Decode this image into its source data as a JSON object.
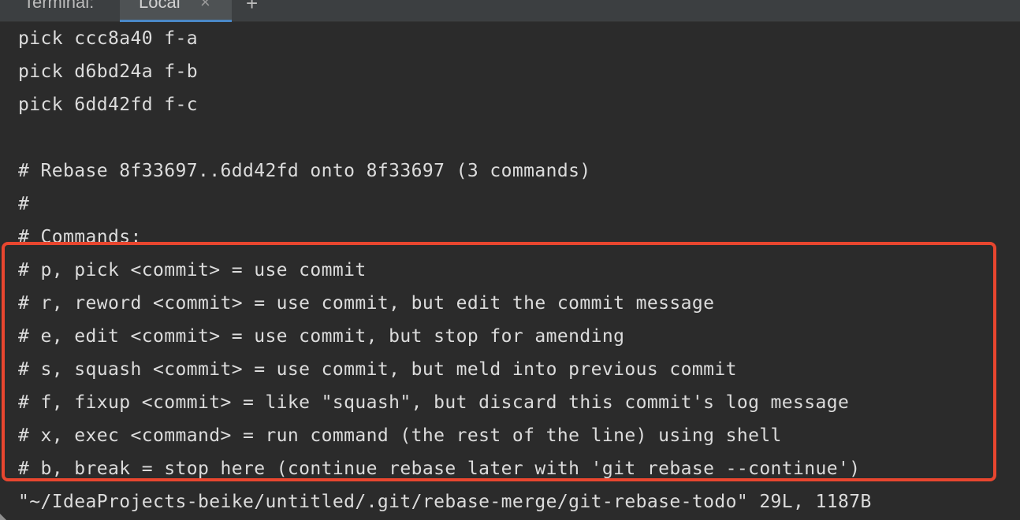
{
  "tabbar": {
    "title": "Terminal:",
    "active_tab": "Local",
    "close_glyph": "×",
    "add_glyph": "+"
  },
  "terminal": {
    "lines": [
      "pick ccc8a40 f-a",
      "pick d6bd24a f-b",
      "pick 6dd42fd f-c",
      "",
      "# Rebase 8f33697..6dd42fd onto 8f33697 (3 commands)",
      "#",
      "# Commands:",
      "# p, pick <commit> = use commit",
      "# r, reword <commit> = use commit, but edit the commit message",
      "# e, edit <commit> = use commit, but stop for amending",
      "# s, squash <commit> = use commit, but meld into previous commit",
      "# f, fixup <commit> = like \"squash\", but discard this commit's log message",
      "# x, exec <command> = run command (the rest of the line) using shell",
      "# b, break = stop here (continue rebase later with 'git rebase --continue')"
    ],
    "status_line": "\"~/IdeaProjects-beike/untitled/.git/rebase-merge/git-rebase-todo\" 29L, 1187B"
  },
  "colors": {
    "background": "#2b2b2b",
    "text": "#dcdcdc",
    "highlight_border": "#e8462f",
    "tab_underline": "#4a88c7"
  }
}
